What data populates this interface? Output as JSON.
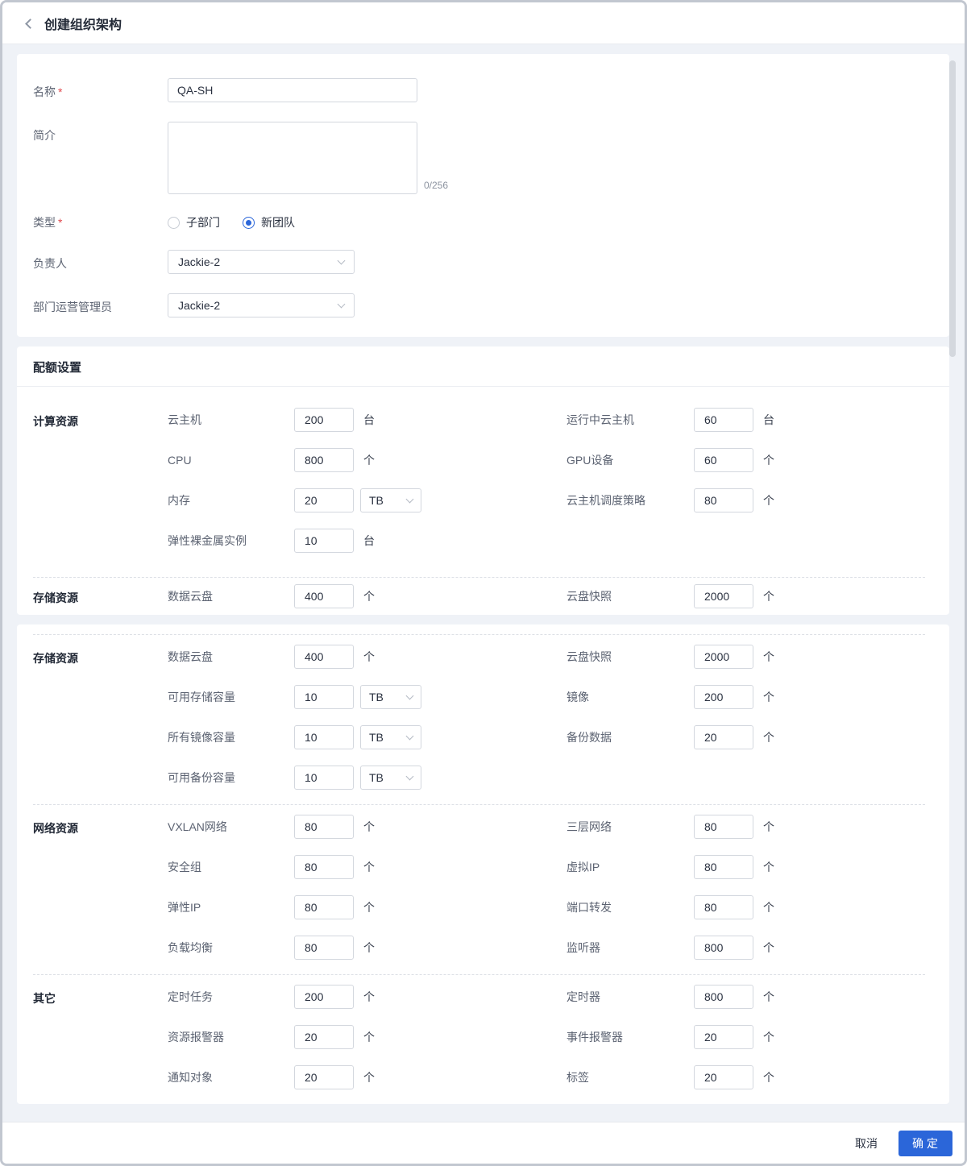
{
  "header": {
    "title": "创建组织架构"
  },
  "form": {
    "required_mark": "*",
    "name": {
      "label": "名称",
      "required": true,
      "value": "QA-SH"
    },
    "intro": {
      "label": "简介",
      "value": "",
      "counter": "0/256"
    },
    "type": {
      "label": "类型",
      "required": true,
      "options": [
        {
          "label": "子部门",
          "selected": false
        },
        {
          "label": "新团队",
          "selected": true
        }
      ]
    },
    "owner": {
      "label": "负责人",
      "value": "Jackie-2"
    },
    "admin": {
      "label": "部门运营管理员",
      "value": "Jackie-2"
    }
  },
  "quota": {
    "title": "配额设置",
    "cards": [
      {
        "groups": [
          {
            "name": "计算资源",
            "rows": [
              {
                "left": {
                  "label": "云主机",
                  "value": "200",
                  "unit": "台"
                },
                "right": {
                  "label": "运行中云主机",
                  "value": "60",
                  "unit": "台"
                }
              },
              {
                "left": {
                  "label": "CPU",
                  "value": "800",
                  "unit": "个"
                },
                "right": {
                  "label": "GPU设备",
                  "value": "60",
                  "unit": "个"
                }
              },
              {
                "left": {
                  "label": "内存",
                  "value": "20",
                  "unit": "TB",
                  "unit_select": true
                },
                "right": {
                  "label": "云主机调度策略",
                  "value": "80",
                  "unit": "个"
                }
              },
              {
                "left": {
                  "label": "弹性裸金属实例",
                  "value": "10",
                  "unit": "台"
                }
              }
            ]
          },
          {
            "name": "存储资源",
            "rows": [
              {
                "left": {
                  "label": "数据云盘",
                  "value": "400",
                  "unit": "个"
                },
                "right": {
                  "label": "云盘快照",
                  "value": "2000",
                  "unit": "个"
                }
              }
            ]
          }
        ]
      },
      {
        "groups": [
          {
            "name": "存储资源",
            "rows": [
              {
                "left": {
                  "label": "数据云盘",
                  "value": "400",
                  "unit": "个"
                },
                "right": {
                  "label": "云盘快照",
                  "value": "2000",
                  "unit": "个"
                }
              },
              {
                "left": {
                  "label": "可用存储容量",
                  "value": "10",
                  "unit": "TB",
                  "unit_select": true
                },
                "right": {
                  "label": "镜像",
                  "value": "200",
                  "unit": "个"
                }
              },
              {
                "left": {
                  "label": "所有镜像容量",
                  "value": "10",
                  "unit": "TB",
                  "unit_select": true
                },
                "right": {
                  "label": "备份数据",
                  "value": "20",
                  "unit": "个"
                }
              },
              {
                "left": {
                  "label": "可用备份容量",
                  "value": "10",
                  "unit": "TB",
                  "unit_select": true
                }
              }
            ]
          },
          {
            "name": "网络资源",
            "rows": [
              {
                "left": {
                  "label": "VXLAN网络",
                  "value": "80",
                  "unit": "个"
                },
                "right": {
                  "label": "三层网络",
                  "value": "80",
                  "unit": "个"
                }
              },
              {
                "left": {
                  "label": "安全组",
                  "value": "80",
                  "unit": "个"
                },
                "right": {
                  "label": "虚拟IP",
                  "value": "80",
                  "unit": "个"
                }
              },
              {
                "left": {
                  "label": "弹性IP",
                  "value": "80",
                  "unit": "个"
                },
                "right": {
                  "label": "端口转发",
                  "value": "80",
                  "unit": "个"
                }
              },
              {
                "left": {
                  "label": "负载均衡",
                  "value": "80",
                  "unit": "个"
                },
                "right": {
                  "label": "监听器",
                  "value": "800",
                  "unit": "个"
                }
              }
            ]
          },
          {
            "name": "其它",
            "rows": [
              {
                "left": {
                  "label": "定时任务",
                  "value": "200",
                  "unit": "个"
                },
                "right": {
                  "label": "定时器",
                  "value": "800",
                  "unit": "个"
                }
              },
              {
                "left": {
                  "label": "资源报警器",
                  "value": "20",
                  "unit": "个"
                },
                "right": {
                  "label": "事件报警器",
                  "value": "20",
                  "unit": "个"
                }
              },
              {
                "left": {
                  "label": "通知对象",
                  "value": "20",
                  "unit": "个"
                },
                "right": {
                  "label": "标签",
                  "value": "20",
                  "unit": "个"
                }
              }
            ]
          }
        ]
      }
    ]
  },
  "footer": {
    "cancel_label": "取消",
    "confirm_label": "确定"
  },
  "colors": {
    "accent": "#2b66d9",
    "required": "#e0484d",
    "page_bg": "#eff2f7"
  }
}
